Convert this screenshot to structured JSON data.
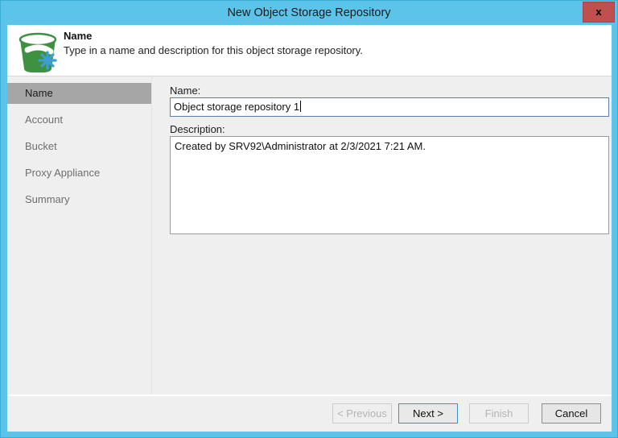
{
  "window": {
    "title": "New Object Storage Repository",
    "close_label": "x",
    "accent_color": "#5bc4e8",
    "close_color": "#c0504d"
  },
  "header": {
    "icon": "bucket-snowflake-icon",
    "title": "Name",
    "subtitle": "Type in a name and description for this object storage repository."
  },
  "sidebar": {
    "items": [
      {
        "label": "Name",
        "selected": true
      },
      {
        "label": "Account",
        "selected": false
      },
      {
        "label": "Bucket",
        "selected": false
      },
      {
        "label": "Proxy Appliance",
        "selected": false
      },
      {
        "label": "Summary",
        "selected": false
      }
    ]
  },
  "form": {
    "name_label": "Name:",
    "name_value": "Object storage repository 1",
    "description_label": "Description:",
    "description_value": "Created by SRV92\\Administrator at 2/3/2021 7:21 AM."
  },
  "footer": {
    "previous_label": "< Previous",
    "next_label": "Next >",
    "finish_label": "Finish",
    "cancel_label": "Cancel"
  }
}
